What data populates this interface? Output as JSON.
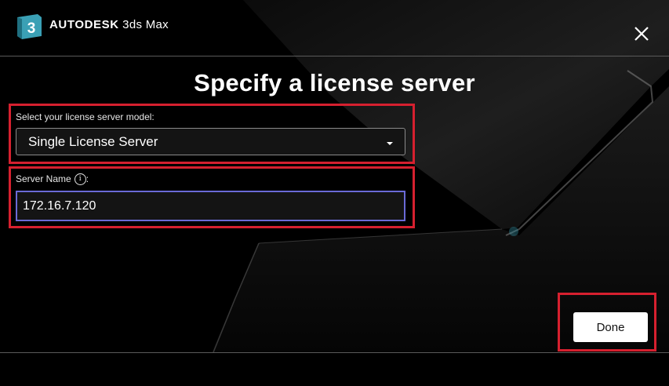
{
  "app": {
    "logo_glyph": "3",
    "brand_name": "AUTODESK",
    "product_name": "3ds Max"
  },
  "dialog": {
    "title": "Specify a license server",
    "model_label": "Select your license server model:",
    "model_value": "Single License Server",
    "server_name_label": "Server Name",
    "server_name_suffix": ":",
    "info_glyph": "i",
    "server_name_value": "172.16.7.120",
    "done_label": "Done"
  },
  "icons": {
    "close": "close-icon",
    "dropdown": "caret-down-icon",
    "info": "info-icon",
    "logo": "3ds-max-logo-icon"
  },
  "colors": {
    "highlight": "#d6202f",
    "input_focus": "#6a6ad6",
    "background": "#000000",
    "button_bg": "#ffffff",
    "logo_teal": "#3aa0b5"
  }
}
